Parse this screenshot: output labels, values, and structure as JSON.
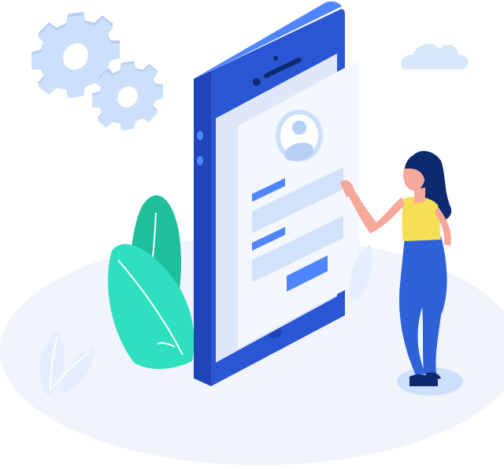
{
  "illustration": {
    "subject": "isometric-phone-login",
    "colors": {
      "phone_body": "#2a56d6",
      "phone_side": "#1f45b8",
      "phone_top": "#4f86ff",
      "card": "#f4f7fd",
      "card_back": "#dfe8fb",
      "field": "#d3e2fb",
      "label": "#4f86ff",
      "button": "#4f86ff",
      "gear": "#cde0fb",
      "gear_shade": "#b6cff5",
      "leaf": "#2ee0bf",
      "leaf_dark": "#1fbf9c",
      "floor": "#f1f4fb",
      "skin": "#f6a89a",
      "hair": "#0e2a6e",
      "top": "#f6df55",
      "pants": "#2f61d9",
      "shoes": "#0e2a6e",
      "cloud": "#d9e7fb"
    },
    "icons": [
      "gear-icon",
      "gear-icon",
      "cloud-icon",
      "leaf-plant-icon",
      "avatar-icon",
      "woman-figure"
    ]
  }
}
